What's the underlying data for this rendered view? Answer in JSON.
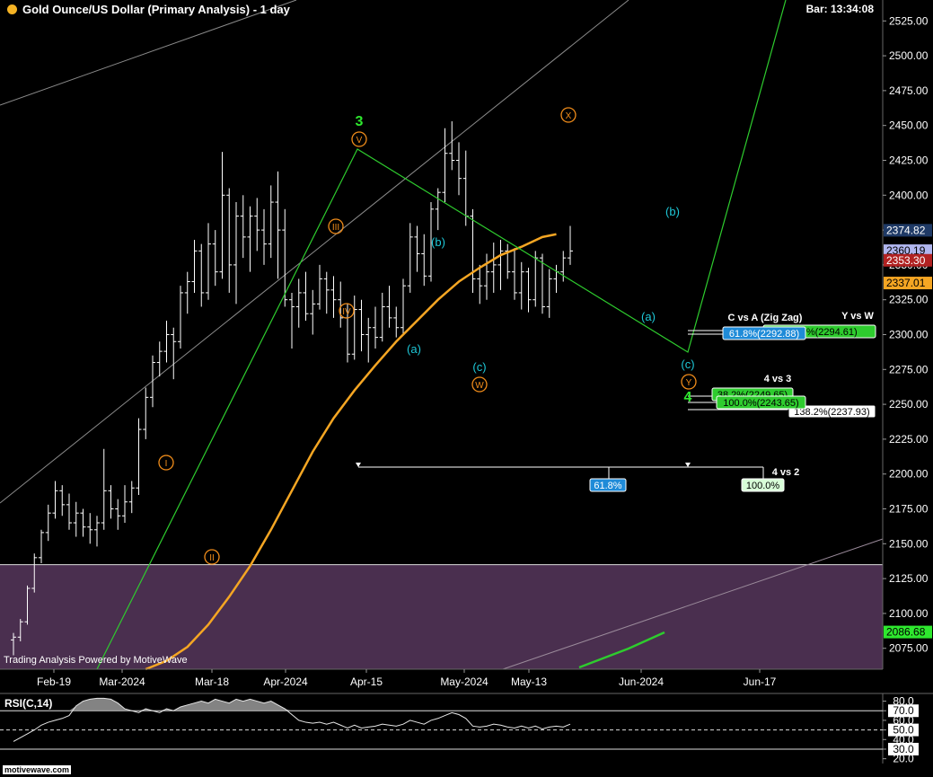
{
  "header": {
    "title": "Gold Ounce/US Dollar (Primary Analysis) - 1 day",
    "bar_timer": "Bar: 13:34:08",
    "powered_by": "Trading Analysis Powered by MotiveWave",
    "rsi_label": "RSI(C,14)",
    "logo_text": "motivewave.com"
  },
  "colors": {
    "background": "#000000",
    "candle": "#ffffff",
    "ma": "#f5a623",
    "wave_line": "#2ecc2e",
    "support_zone": "#4a2f4f",
    "cyan_label": "#1ec8d8",
    "orange_label": "#f08c1a",
    "green_label": "#2ee82e"
  },
  "chart_data": {
    "type": "ohlc-bar",
    "title": "Gold Ounce/US Dollar (Primary Analysis) - 1 day",
    "ylim": [
      2060,
      2540
    ],
    "y_ticks": [
      2075,
      2100,
      2125,
      2150,
      2175,
      2200,
      2225,
      2250,
      2275,
      2300,
      2325,
      2350,
      2375,
      2400,
      2425,
      2450,
      2475,
      2500,
      2525
    ],
    "y_tick_labels": [
      "2075.00",
      "2100.00",
      "2125.00",
      "2150.00",
      "2175.00",
      "2200.00",
      "2225.00",
      "2250.00",
      "2275.00",
      "2300.00",
      "2325.00",
      "2350.00",
      "2375.00",
      "2400.00",
      "2425.00",
      "2450.00",
      "2475.00",
      "2500.00",
      "2525.00"
    ],
    "x_axis_labels": [
      {
        "label": "Feb-19",
        "bar": 0
      },
      {
        "label": "Mar-2024",
        "bar": 9
      },
      {
        "label": "Mar-18",
        "bar": 19
      },
      {
        "label": "Apr-2024",
        "bar": 30
      },
      {
        "label": "Apr-15",
        "bar": 39
      },
      {
        "label": "May-2024",
        "bar": 51
      },
      {
        "label": "May-13",
        "bar": 59
      },
      {
        "label": "Jun-2024",
        "bar": 73
      },
      {
        "label": "Jun-17",
        "bar": 88
      }
    ],
    "bars": [
      [
        2081,
        2086,
        2070,
        2083
      ],
      [
        2083,
        2096,
        2080,
        2094
      ],
      [
        2094,
        2120,
        2092,
        2118
      ],
      [
        2118,
        2143,
        2115,
        2140
      ],
      [
        2140,
        2160,
        2136,
        2158
      ],
      [
        2158,
        2178,
        2152,
        2172
      ],
      [
        2172,
        2195,
        2168,
        2188
      ],
      [
        2188,
        2192,
        2170,
        2178
      ],
      [
        2178,
        2186,
        2160,
        2165
      ],
      [
        2165,
        2180,
        2155,
        2172
      ],
      [
        2172,
        2175,
        2155,
        2162
      ],
      [
        2162,
        2172,
        2150,
        2160
      ],
      [
        2160,
        2170,
        2148,
        2165
      ],
      [
        2165,
        2218,
        2160,
        2188
      ],
      [
        2188,
        2192,
        2168,
        2175
      ],
      [
        2175,
        2182,
        2160,
        2170
      ],
      [
        2170,
        2192,
        2165,
        2180
      ],
      [
        2180,
        2195,
        2172,
        2190
      ],
      [
        2190,
        2240,
        2185,
        2232
      ],
      [
        2232,
        2262,
        2225,
        2255
      ],
      [
        2255,
        2285,
        2248,
        2280
      ],
      [
        2280,
        2295,
        2270,
        2288
      ],
      [
        2288,
        2310,
        2280,
        2300
      ],
      [
        2300,
        2305,
        2268,
        2295
      ],
      [
        2295,
        2335,
        2290,
        2330
      ],
      [
        2330,
        2345,
        2315,
        2338
      ],
      [
        2338,
        2368,
        2330,
        2360
      ],
      [
        2360,
        2365,
        2320,
        2330
      ],
      [
        2330,
        2380,
        2325,
        2365
      ],
      [
        2365,
        2375,
        2335,
        2345
      ],
      [
        2345,
        2431,
        2340,
        2400
      ],
      [
        2400,
        2405,
        2330,
        2350
      ],
      [
        2350,
        2395,
        2322,
        2385
      ],
      [
        2385,
        2400,
        2355,
        2370
      ],
      [
        2370,
        2392,
        2345,
        2385
      ],
      [
        2385,
        2398,
        2360,
        2375
      ],
      [
        2375,
        2390,
        2350,
        2365
      ],
      [
        2365,
        2407,
        2355,
        2395
      ],
      [
        2395,
        2417,
        2340,
        2375
      ],
      [
        2375,
        2390,
        2320,
        2325
      ],
      [
        2325,
        2330,
        2290,
        2320
      ],
      [
        2320,
        2340,
        2305,
        2330
      ],
      [
        2330,
        2345,
        2310,
        2315
      ],
      [
        2315,
        2332,
        2300,
        2322
      ],
      [
        2322,
        2350,
        2318,
        2340
      ],
      [
        2340,
        2345,
        2315,
        2332
      ],
      [
        2332,
        2342,
        2312,
        2325
      ],
      [
        2325,
        2338,
        2305,
        2312
      ],
      [
        2312,
        2322,
        2280,
        2286
      ],
      [
        2286,
        2328,
        2282,
        2318
      ],
      [
        2318,
        2325,
        2288,
        2300
      ],
      [
        2300,
        2312,
        2280,
        2305
      ],
      [
        2305,
        2320,
        2290,
        2298
      ],
      [
        2298,
        2330,
        2295,
        2320
      ],
      [
        2320,
        2335,
        2305,
        2312
      ],
      [
        2312,
        2320,
        2298,
        2305
      ],
      [
        2305,
        2340,
        2300,
        2335
      ],
      [
        2335,
        2380,
        2330,
        2370
      ],
      [
        2370,
        2378,
        2345,
        2358
      ],
      [
        2358,
        2372,
        2335,
        2342
      ],
      [
        2342,
        2395,
        2338,
        2390
      ],
      [
        2390,
        2405,
        2375,
        2402
      ],
      [
        2402,
        2448,
        2395,
        2430
      ],
      [
        2430,
        2453,
        2418,
        2425
      ],
      [
        2425,
        2438,
        2400,
        2412
      ],
      [
        2412,
        2432,
        2378,
        2385
      ],
      [
        2385,
        2390,
        2330,
        2340
      ],
      [
        2340,
        2350,
        2322,
        2335
      ],
      [
        2335,
        2358,
        2325,
        2345
      ],
      [
        2345,
        2366,
        2330,
        2350
      ],
      [
        2350,
        2368,
        2332,
        2360
      ],
      [
        2360,
        2365,
        2340,
        2345
      ],
      [
        2345,
        2362,
        2325,
        2330
      ],
      [
        2330,
        2352,
        2318,
        2345
      ],
      [
        2345,
        2348,
        2316,
        2325
      ],
      [
        2325,
        2360,
        2320,
        2355
      ],
      [
        2355,
        2358,
        2315,
        2320
      ],
      [
        2320,
        2347,
        2312,
        2340
      ],
      [
        2340,
        2350,
        2330,
        2345
      ],
      [
        2345,
        2360,
        2338,
        2355
      ],
      [
        2355,
        2378,
        2350,
        2360
      ]
    ],
    "moving_average": [
      [
        19,
        2060
      ],
      [
        22,
        2066
      ],
      [
        25,
        2076
      ],
      [
        28,
        2092
      ],
      [
        31,
        2112
      ],
      [
        34,
        2134
      ],
      [
        37,
        2160
      ],
      [
        40,
        2188
      ],
      [
        43,
        2216
      ],
      [
        46,
        2240
      ],
      [
        49,
        2260
      ],
      [
        52,
        2278
      ],
      [
        55,
        2295
      ],
      [
        58,
        2310
      ],
      [
        61,
        2325
      ],
      [
        64,
        2338
      ],
      [
        67,
        2348
      ],
      [
        70,
        2357
      ],
      [
        73,
        2363
      ],
      [
        76,
        2370
      ],
      [
        78,
        2372
      ]
    ],
    "price_labels": [
      {
        "text": "2374.82",
        "value": 2374.82,
        "bg": "#1f3a66",
        "fg": "#ffffff"
      },
      {
        "text": "2360.19",
        "value": 2360.19,
        "bg": "#b0b6ef",
        "fg": "#000000"
      },
      {
        "text": "2353.30",
        "value": 2353.3,
        "bg": "#b12222",
        "fg": "#ffffff"
      },
      {
        "text": "2337.01",
        "value": 2337.01,
        "bg": "#f5a623",
        "fg": "#000000"
      },
      {
        "text": "2086.68",
        "value": 2086.68,
        "bg": "#2ee82e",
        "fg": "#000000"
      }
    ],
    "support_zone": [
      2060,
      2135
    ],
    "fib_annotations": {
      "c_vs_a": "C vs A (Zig Zag)",
      "y_vs_w": "Y vs W",
      "fib_618_cva": "61.8%(2292.88)",
      "fib_100_yvw": "100.0%(2294.61)",
      "four_vs_three": "4 vs 3",
      "fib_382_4v3": "38.2%(2249.65)",
      "fib_100_4v3": "100.0%(2243.65)",
      "fib_1382_4v3": "138.2%(2237.93)",
      "four_vs_two": "4 vs 2",
      "fib_618_4v2": "61.8%",
      "fib_100_4v2": "100.0%"
    },
    "wave_labels": {
      "w3": "3",
      "w4": "4",
      "i": "I",
      "ii": "II",
      "iii": "III",
      "iv": "IV",
      "v": "V",
      "x": "X",
      "w": "W",
      "y": "Y",
      "a1": "(a)",
      "b1": "(b)",
      "c1": "(c)",
      "a2": "(a)",
      "b2": "(b)",
      "c2": "(c)"
    },
    "rsi": {
      "ylim": [
        15,
        88
      ],
      "ticks": [
        20,
        30,
        40,
        50,
        60,
        70,
        80
      ],
      "tick_labels": [
        "20.0",
        "30.0",
        "40.0",
        "50.0",
        "60.0",
        "70.0",
        "80.0"
      ],
      "highlight_labels": [
        "70.0",
        "50.0",
        "30.0"
      ],
      "values": [
        [
          0,
          38
        ],
        [
          1,
          42
        ],
        [
          2,
          46
        ],
        [
          3,
          50
        ],
        [
          4,
          55
        ],
        [
          5,
          58
        ],
        [
          6,
          60
        ],
        [
          7,
          62
        ],
        [
          8,
          65
        ],
        [
          9,
          75
        ],
        [
          10,
          80
        ],
        [
          11,
          82
        ],
        [
          12,
          83
        ],
        [
          13,
          83
        ],
        [
          14,
          82
        ],
        [
          15,
          78
        ],
        [
          16,
          72
        ],
        [
          17,
          70
        ],
        [
          18,
          68
        ],
        [
          19,
          72
        ],
        [
          20,
          70
        ],
        [
          21,
          68
        ],
        [
          22,
          72
        ],
        [
          23,
          70
        ],
        [
          24,
          74
        ],
        [
          25,
          76
        ],
        [
          26,
          78
        ],
        [
          27,
          80
        ],
        [
          28,
          78
        ],
        [
          29,
          82
        ],
        [
          30,
          80
        ],
        [
          31,
          78
        ],
        [
          32,
          82
        ],
        [
          33,
          80
        ],
        [
          34,
          82
        ],
        [
          35,
          80
        ],
        [
          36,
          78
        ],
        [
          37,
          80
        ],
        [
          38,
          76
        ],
        [
          39,
          72
        ],
        [
          40,
          66
        ],
        [
          41,
          60
        ],
        [
          42,
          58
        ],
        [
          43,
          57
        ],
        [
          44,
          58
        ],
        [
          45,
          56
        ],
        [
          46,
          58
        ],
        [
          47,
          55
        ],
        [
          48,
          52
        ],
        [
          49,
          55
        ],
        [
          50,
          52
        ],
        [
          51,
          53
        ],
        [
          52,
          54
        ],
        [
          53,
          56
        ],
        [
          54,
          55
        ],
        [
          55,
          54
        ],
        [
          56,
          56
        ],
        [
          57,
          60
        ],
        [
          58,
          58
        ],
        [
          59,
          56
        ],
        [
          60,
          60
        ],
        [
          61,
          62
        ],
        [
          62,
          65
        ],
        [
          63,
          68
        ],
        [
          64,
          66
        ],
        [
          65,
          62
        ],
        [
          66,
          54
        ],
        [
          67,
          53
        ],
        [
          68,
          54
        ],
        [
          69,
          56
        ],
        [
          70,
          55
        ],
        [
          71,
          53
        ],
        [
          72,
          52
        ],
        [
          73,
          54
        ],
        [
          74,
          52
        ],
        [
          75,
          54
        ],
        [
          76,
          51
        ],
        [
          77,
          53
        ],
        [
          78,
          54
        ],
        [
          79,
          53
        ],
        [
          80,
          56
        ]
      ]
    }
  }
}
